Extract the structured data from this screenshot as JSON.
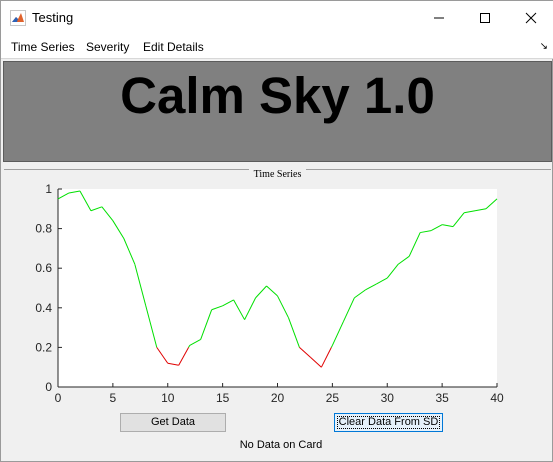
{
  "window": {
    "title": "Testing"
  },
  "menu": {
    "items": [
      "Time Series",
      "Severity",
      "Edit Details"
    ],
    "arrow": "↘"
  },
  "header": {
    "title": "Calm Sky 1.0",
    "background": "#808080"
  },
  "panel": {
    "title": "Time Series"
  },
  "chart_data": {
    "type": "line",
    "xlim": [
      0,
      40
    ],
    "ylim": [
      0,
      1
    ],
    "x_ticks": [
      0,
      5,
      10,
      15,
      20,
      25,
      30,
      35,
      40
    ],
    "y_ticks": [
      0,
      0.2,
      0.4,
      0.6,
      0.8,
      1
    ],
    "x_tick_labels": [
      "0",
      "5",
      "10",
      "15",
      "20",
      "25",
      "30",
      "35",
      "40"
    ],
    "y_tick_labels": [
      "0",
      "0.2",
      "0.4",
      "0.6",
      "0.8",
      "1"
    ],
    "threshold": 0.2,
    "color_above": "#00e000",
    "color_below": "#e00000",
    "x": [
      0,
      1,
      2,
      3,
      4,
      5,
      6,
      7,
      8,
      9,
      10,
      11,
      12,
      13,
      14,
      15,
      16,
      17,
      18,
      19,
      20,
      21,
      22,
      23,
      24,
      25,
      26,
      27,
      28,
      29,
      30,
      31,
      32,
      33,
      34,
      35,
      36,
      37,
      38,
      39,
      40
    ],
    "y": [
      0.95,
      0.98,
      0.99,
      0.89,
      0.91,
      0.84,
      0.75,
      0.62,
      0.41,
      0.2,
      0.12,
      0.11,
      0.21,
      0.24,
      0.39,
      0.41,
      0.44,
      0.34,
      0.45,
      0.51,
      0.46,
      0.35,
      0.2,
      0.15,
      0.1,
      0.21,
      0.33,
      0.45,
      0.49,
      0.52,
      0.55,
      0.62,
      0.66,
      0.78,
      0.79,
      0.82,
      0.81,
      0.88,
      0.89,
      0.9,
      0.95
    ],
    "grid": false
  },
  "buttons": {
    "get_data": "Get Data",
    "clear_data": "Clear Data From SD"
  },
  "status": {
    "text": "No Data on Card"
  }
}
